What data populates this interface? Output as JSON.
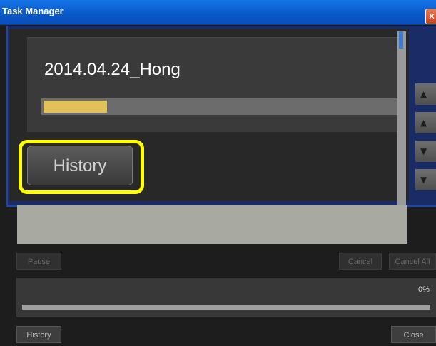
{
  "window": {
    "title": "Task Manager",
    "close_glyph": "✕"
  },
  "job": {
    "name": "2014.04.24_Hong",
    "progress": 0.18
  },
  "zoom_callout": {
    "history_label": "History"
  },
  "side_buttons": [
    {
      "icon": "move-to-top-icon",
      "glyph": "▲"
    },
    {
      "icon": "move-up-icon",
      "glyph": "▲"
    },
    {
      "icon": "move-down-icon",
      "glyph": "▼"
    },
    {
      "icon": "move-to-bottom-icon",
      "glyph": "▼"
    }
  ],
  "controls": {
    "pause_label": "Pause",
    "cancel_label": "Cancel",
    "cancel_all_label": "Cancel All",
    "history_label": "History",
    "close_label": "Close"
  },
  "overall": {
    "percent_text": "0%",
    "progress": 0.0
  },
  "colors": {
    "highlight": "#ffff00",
    "progress": "#e2c05a",
    "titlebar": "#0a58c8"
  }
}
